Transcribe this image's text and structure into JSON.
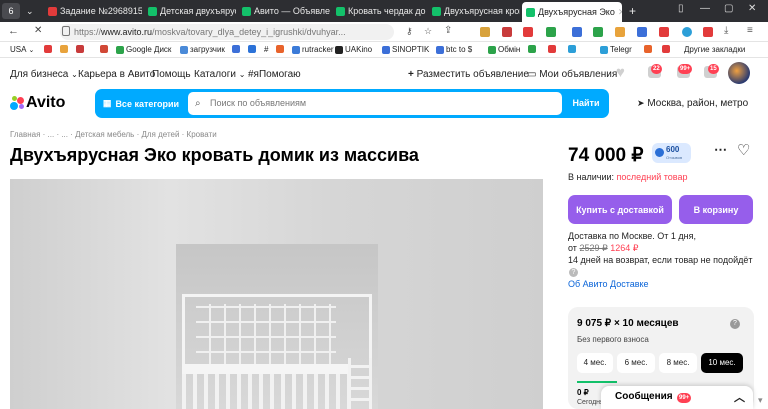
{
  "browser": {
    "tabs": [
      {
        "label": "Задание №2968915",
        "favicon_color": "#e23b3b"
      },
      {
        "label": "Детская двухъярусная",
        "favicon_color": "#13c16a"
      },
      {
        "label": "Авито — Объявления",
        "favicon_color": "#13c16a"
      },
      {
        "label": "Кровать чердак домик",
        "favicon_color": "#13c16a"
      },
      {
        "label": "Двухъярусная кровать",
        "favicon_color": "#13c16a"
      },
      {
        "label": "Двухъярусная Эко",
        "favicon_color": "#13c16a"
      }
    ],
    "tab_counter": "6",
    "new_tab": "+",
    "url_domain": "www.avito.ru",
    "url_path": "/moskva/tovary_dlya_detey_i_igrushki/dvuhyar...",
    "url_prefix": "https://",
    "bookmarks": [
      {
        "label": "USA",
        "color": "#3c6fd8"
      },
      {
        "label": "",
        "color": "#e23b3b"
      },
      {
        "label": "",
        "color": "#e8a33c"
      },
      {
        "label": "",
        "color": "#c83b3b"
      },
      {
        "label": "",
        "color": "#d14836"
      },
      {
        "label": "Google Диск",
        "color": "#2ca34a"
      },
      {
        "label": "загрузчик",
        "color": "#4a8ad8"
      },
      {
        "label": "",
        "color": "#3c6fd8"
      },
      {
        "label": "",
        "color": "#2c72d8"
      },
      {
        "label": "#",
        "color": "#777777"
      },
      {
        "label": "",
        "color": "#e8632b"
      },
      {
        "label": "rutracker",
        "color": "#3b7bd8"
      },
      {
        "label": "UAKino",
        "color": "#222222"
      },
      {
        "label": "SINOPTIK",
        "color": "#3c6fd8"
      },
      {
        "label": "btc to $",
        "color": "#3c6fd8"
      },
      {
        "label": "Обмін",
        "color": "#2ca34a"
      },
      {
        "label": "",
        "color": "#2ca34a"
      },
      {
        "label": "",
        "color": "#e23b3b"
      },
      {
        "label": "",
        "color": "#2c9fd8"
      },
      {
        "label": "Telegr",
        "color": "#2c9fd8"
      },
      {
        "label": "",
        "color": "#e8632b"
      },
      {
        "label": "",
        "color": "#e23b3b"
      }
    ],
    "other_bookmarks": "Другие закладки"
  },
  "avito": {
    "top_nav": {
      "business": "Для бизнеса",
      "career": "Карьера в Авито",
      "help": "Помощь",
      "catalogs": "Каталоги",
      "hashtag": "#яПомогаю",
      "post_ad": "Разместить объявление",
      "my_ads": "Мои объявления",
      "badges": [
        "22",
        "99+",
        "15"
      ]
    },
    "logo_text": "Avito",
    "search": {
      "categories_label": "Все категории",
      "placeholder": "Поиск по объявлениям",
      "find_label": "Найти",
      "location": "Москва, район, метро"
    },
    "breadcrumb": "Главная · ... · ... · Детская мебель · Для детей · Кровати",
    "title": "Двухъярусная Эко кровать домик из массива",
    "price": "74 000 ₽",
    "rating": {
      "count": "600",
      "sub": "Отзывов"
    },
    "stock_label": "В наличии:",
    "stock_value": "последний товар",
    "buy_delivery": "Купить с доставкой",
    "to_cart": "В корзину",
    "delivery_line": "Доставка по Москве. От 1 дня,",
    "delivery_from": "от",
    "delivery_old_price": "2529 ₽",
    "delivery_new_price": "1264 ₽",
    "return_line": "14 дней на возврат, если товар не подойдёт",
    "about_delivery": "Об Авито Доставке",
    "installment": {
      "amount": "9 075 ₽ × 10 месяцев",
      "sub": "Без первого взноса",
      "months": [
        "4 мес.",
        "6 мес.",
        "8 мес.",
        "10 мес."
      ],
      "selected_index": 3,
      "pay_now": "0 ₽",
      "today": "Сегодня"
    },
    "messages_label": "Сообщения",
    "messages_badge": "99+",
    "colors": {
      "accent_blue": "#00aaff",
      "purple": "#965eeb",
      "red_link": "#ff4053"
    }
  }
}
